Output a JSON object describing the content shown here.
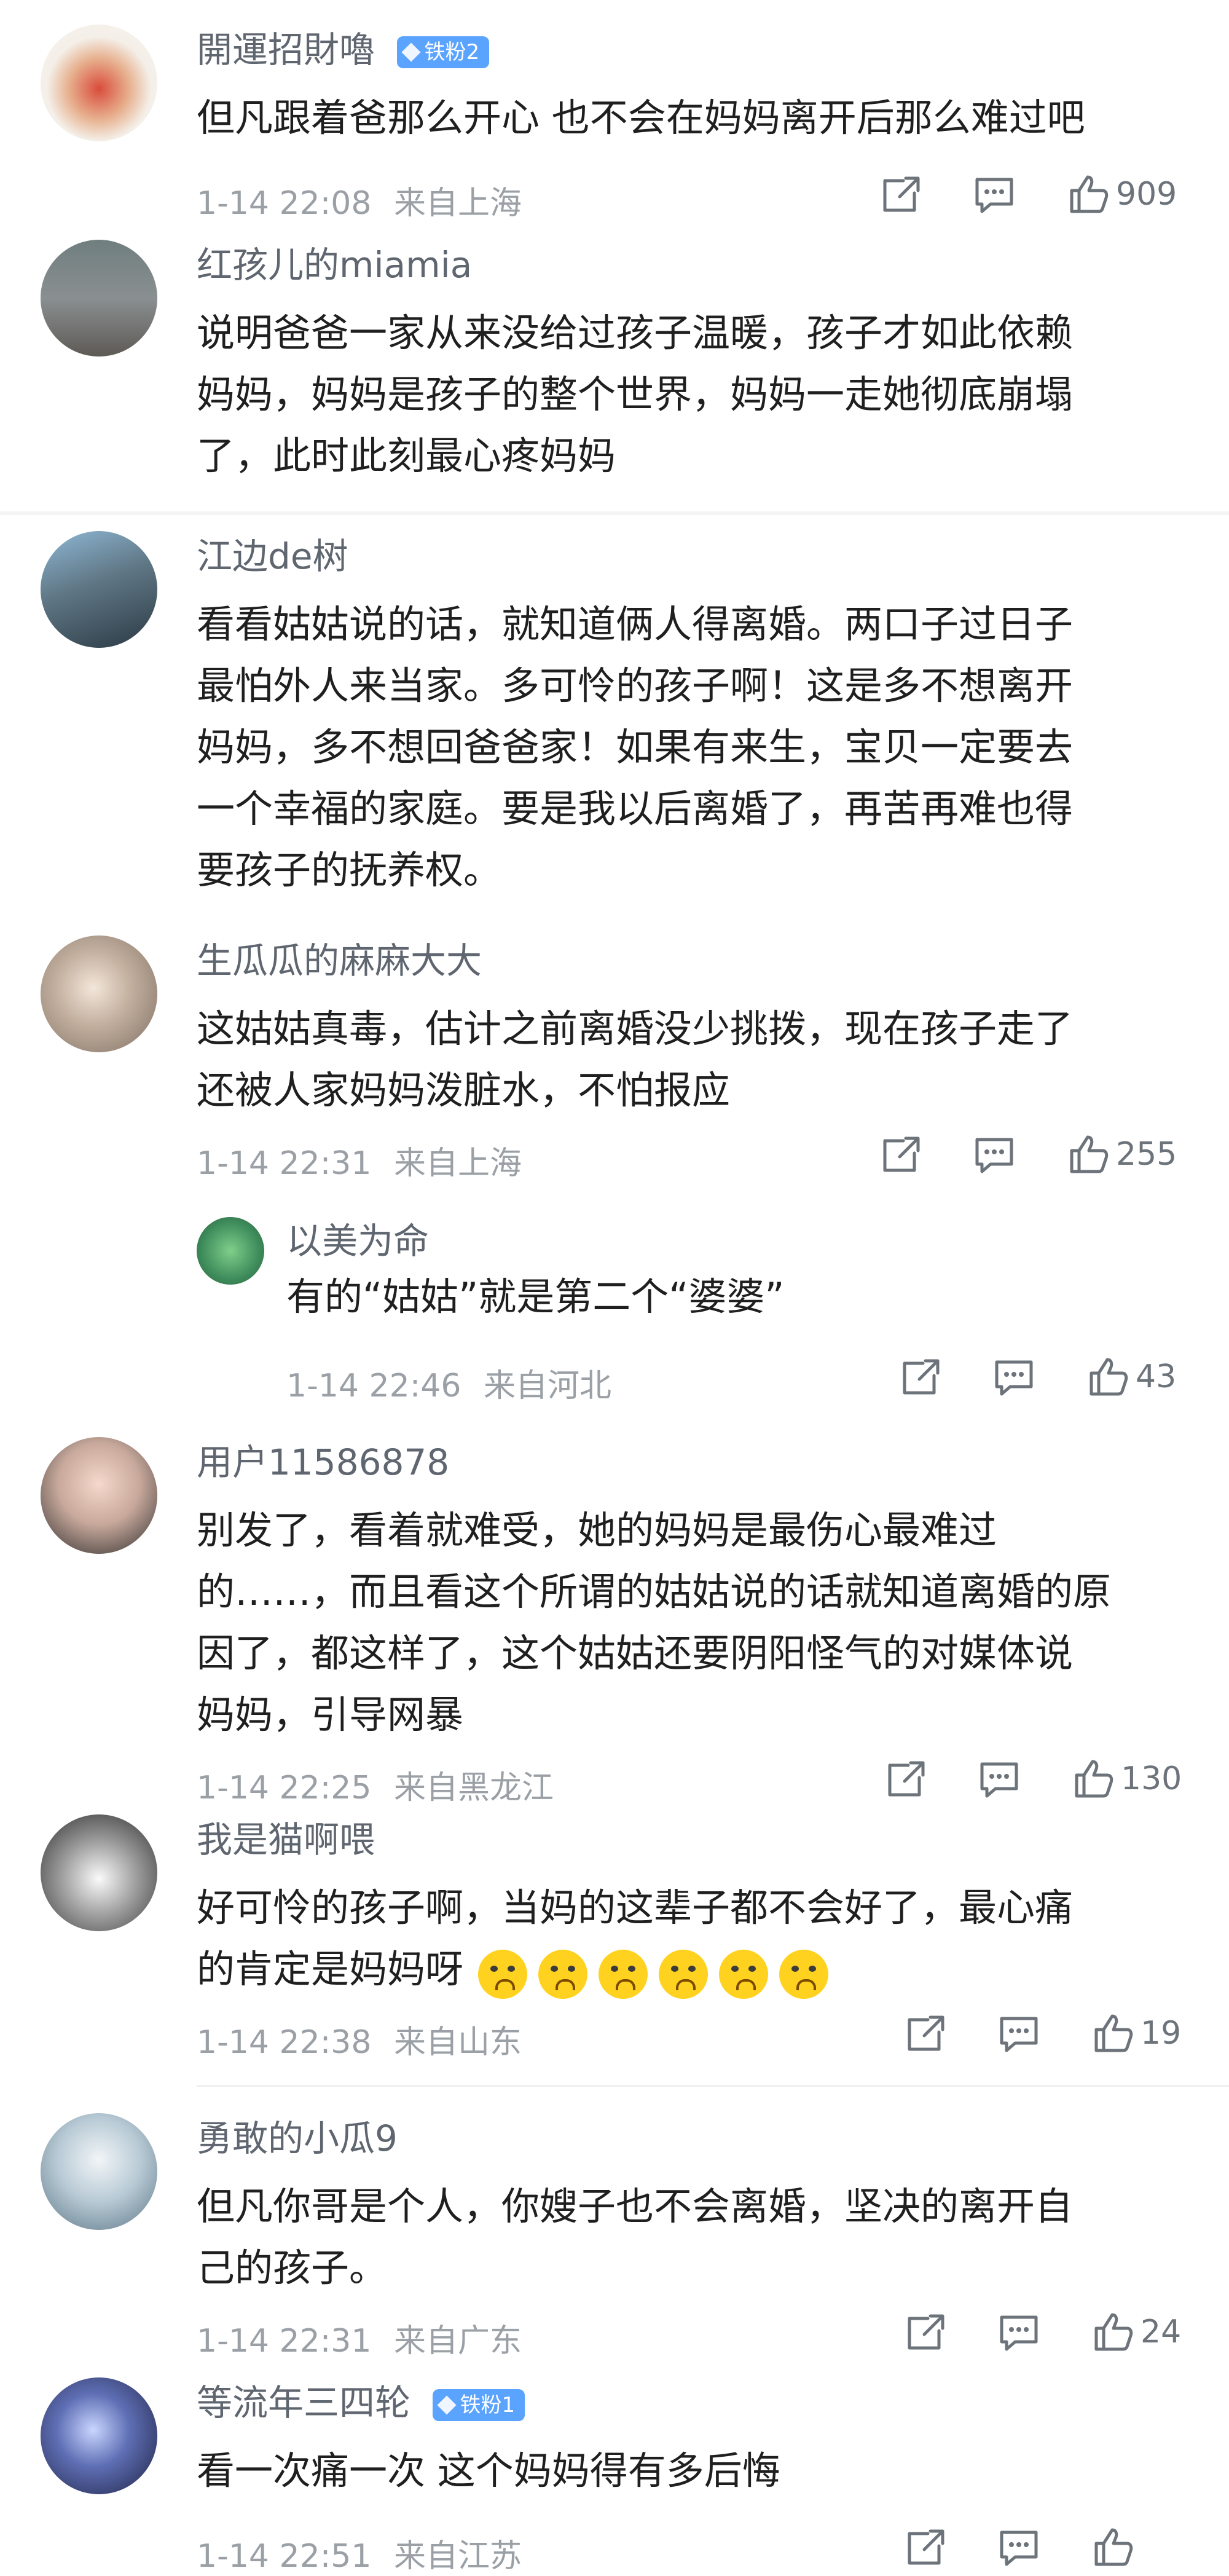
{
  "comments": [
    {
      "user": "開運招財嚕",
      "badge": "铁粉2",
      "text": "但凡跟着爸那么开心 也不会在妈妈离开后那么难过吧",
      "time": "1-14 22:08",
      "location": "来自上海",
      "likes": "909"
    },
    {
      "user": "红孩儿的miamia",
      "text": "说明爸爸一家从来没给过孩子温暖，孩子才如此依赖\n妈妈，妈妈是孩子的整个世界，妈妈一走她彻底崩塌\n了，此时此刻最心疼妈妈"
    },
    {
      "user": "江边de树",
      "text": "看看姑姑说的话，就知道俩人得离婚。两口子过日子\n最怕外人来当家。多可怜的孩子啊！这是多不想离开\n妈妈，多不想回爸爸家！如果有来生，宝贝一定要去\n一个幸福的家庭。要是我以后离婚了，再苦再难也得\n要孩子的抚养权。"
    },
    {
      "user": "生瓜瓜的麻麻大大",
      "text": "这姑姑真毒，估计之前离婚没少挑拨，现在孩子走了\n还被人家妈妈泼脏水，不怕报应",
      "time": "1-14 22:31",
      "location": "来自上海",
      "likes": "255"
    },
    {
      "user": "以美为命",
      "text": "有的“姑姑”就是第二个“婆婆”",
      "time": "1-14 22:46",
      "location": "来自河北",
      "likes": "43"
    },
    {
      "user": "用户11586878",
      "text": "别发了，看着就难受，她的妈妈是最伤心最难过\n的……，而且看这个所谓的姑姑说的话就知道离婚的原\n因了，都这样了，这个姑姑还要阴阳怪气的对媒体说\n妈妈，引导网暴",
      "time": "1-14 22:25",
      "location": "来自黑龙江",
      "likes": "130"
    },
    {
      "user": "我是猫啊喂",
      "text": "好可怜的孩子啊，当妈的这辈子都不会好了，最心痛\n的肯定是妈妈呀",
      "emoji_count": 6,
      "time": "1-14 22:38",
      "location": "来自山东",
      "likes": "19"
    },
    {
      "user": "勇敢的小瓜9",
      "text": "但凡你哥是个人，你嫂子也不会离婚，坚决的离开自\n己的孩子。",
      "time": "1-14 22:31",
      "location": "来自广东",
      "likes": "24"
    },
    {
      "user": "等流年三四轮",
      "badge": "铁粉1",
      "text": "看一次痛一次 这个妈妈得有多后悔",
      "time": "1-14 22:51",
      "location": "来自江苏"
    }
  ],
  "colors": {
    "badge": "#5aa3ff",
    "meta": "#9aa0a6",
    "name": "#5f6670",
    "text": "#1f1f1f"
  }
}
